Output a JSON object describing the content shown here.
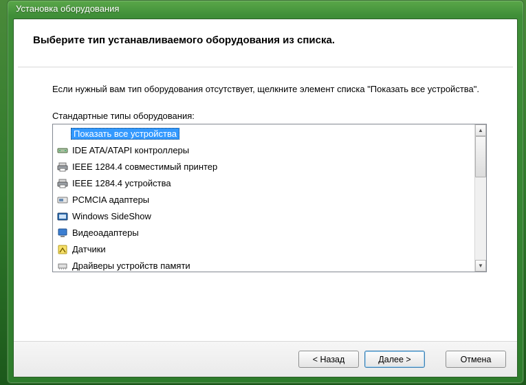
{
  "window": {
    "title": "Установка оборудования"
  },
  "wizard": {
    "title": "Выберите тип устанавливаемого оборудования из списка.",
    "info": "Если нужный вам тип оборудования отсутствует, щелкните элемент списка \"Показать все устройства\".",
    "list_label": "Стандартные типы оборудования:"
  },
  "hardware_types": [
    {
      "label": "Показать все устройства",
      "icon": "blank",
      "selected": true
    },
    {
      "label": "IDE ATA/ATAPI контроллеры",
      "icon": "ide",
      "selected": false
    },
    {
      "label": "IEEE 1284.4 совместимый принтер",
      "icon": "printer",
      "selected": false
    },
    {
      "label": "IEEE 1284.4 устройства",
      "icon": "printer",
      "selected": false
    },
    {
      "label": "PCMCIA адаптеры",
      "icon": "pcmcia",
      "selected": false
    },
    {
      "label": "Windows SideShow",
      "icon": "sideshow",
      "selected": false
    },
    {
      "label": "Видеоадаптеры",
      "icon": "display",
      "selected": false
    },
    {
      "label": "Датчики",
      "icon": "sensor",
      "selected": false
    },
    {
      "label": "Драйверы устройств памяти",
      "icon": "memory",
      "selected": false
    }
  ],
  "buttons": {
    "back": "< Назад",
    "next": "Далее >",
    "cancel": "Отмена"
  }
}
